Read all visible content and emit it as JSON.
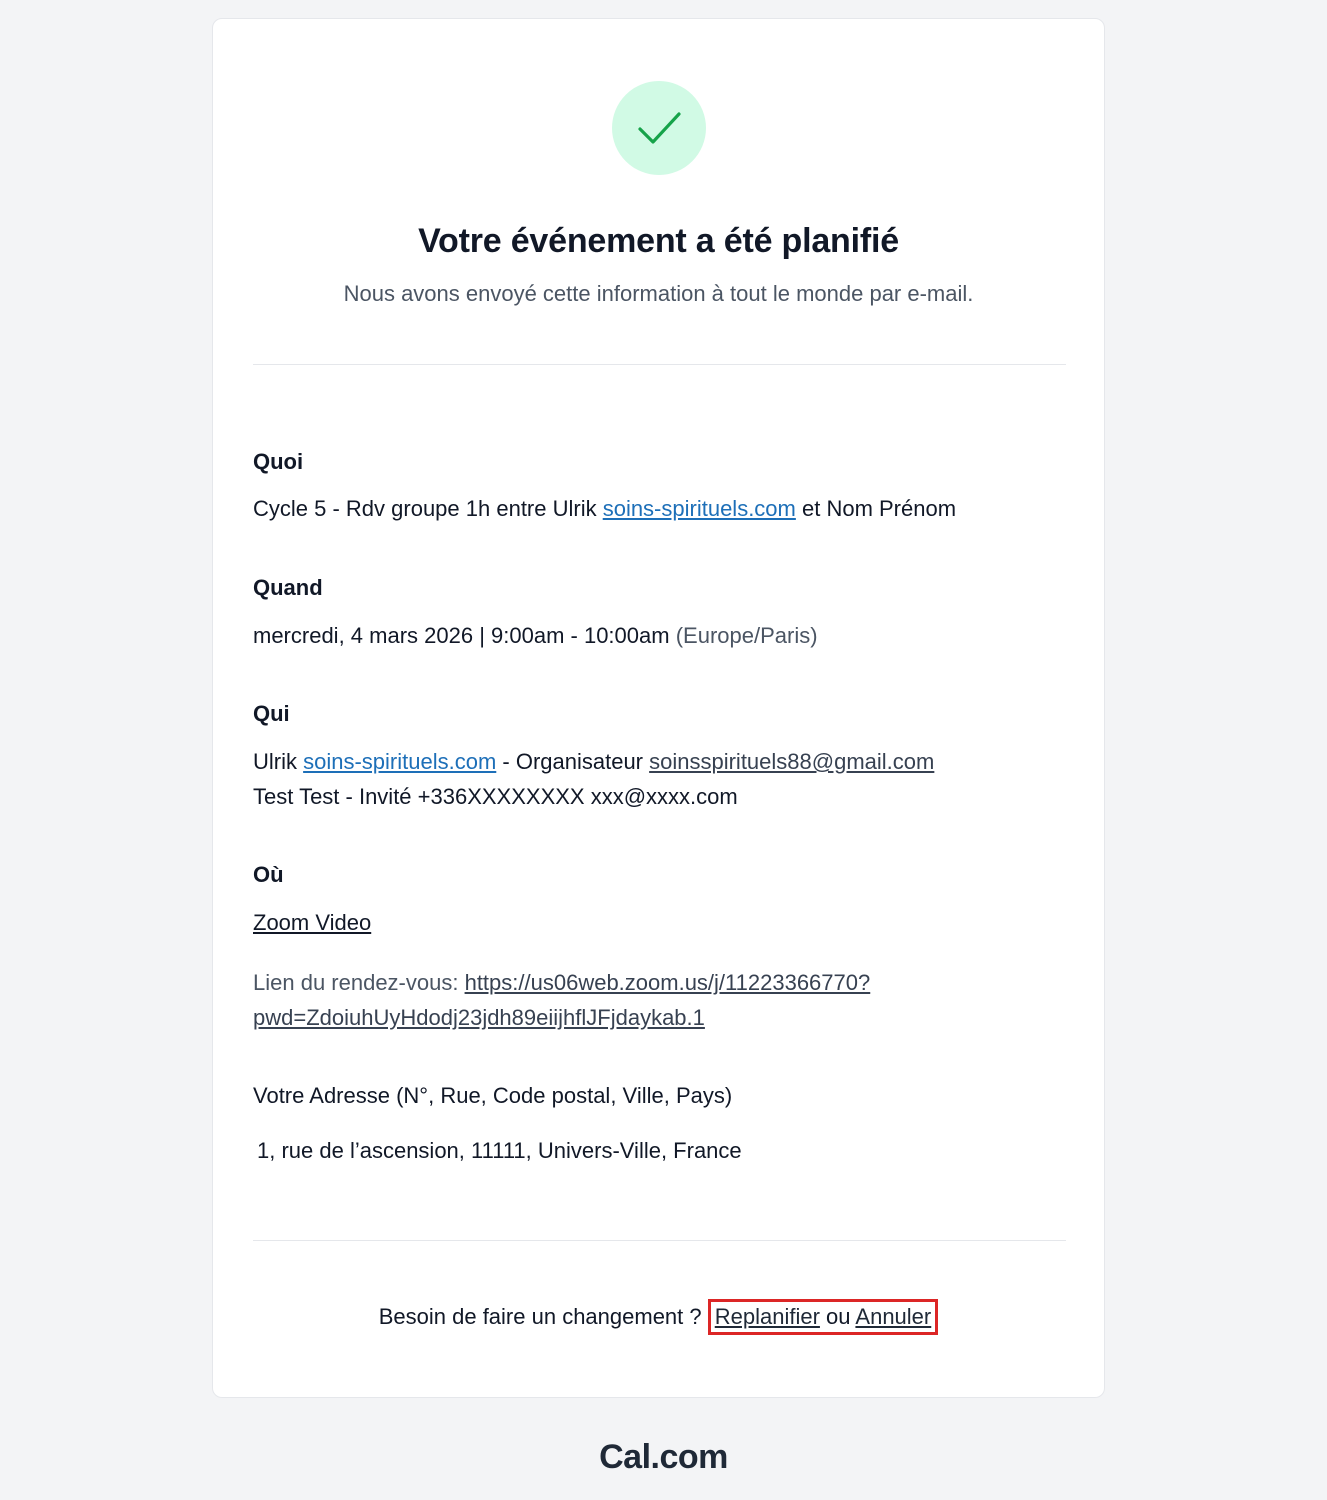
{
  "header": {
    "title": "Votre événement a été planifié",
    "subtitle": "Nous avons envoyé cette information à tout le monde par e-mail."
  },
  "what": {
    "label": "Quoi",
    "prefix": "Cycle 5 - Rdv groupe 1h entre Ulrik ",
    "link": "soins-spirituels.com",
    "suffix": " et Nom Prénom"
  },
  "when": {
    "label": "Quand",
    "datetime": "mercredi, 4 mars 2026 | 9:00am - 10:00am",
    "timezone": "(Europe/Paris)"
  },
  "who": {
    "label": "Qui",
    "organizer_name": "Ulrik ",
    "organizer_link": "soins-spirituels.com",
    "organizer_role": " - Organisateur ",
    "organizer_email": "soinsspirituels88@gmail.com",
    "guest": "Test Test - Invité +336XXXXXXXX xxx@xxxx.com"
  },
  "where": {
    "label": "Où",
    "location": "Zoom Video",
    "meeting_link_label": "Lien du rendez-vous: ",
    "meeting_link_part1": "https://us06web.zoom.us/j/11223366770?",
    "meeting_link_part2": "pwd=ZdoiuhUyHdodj23jdh89eiijhflJFjdaykab.1"
  },
  "address": {
    "label": "Votre Adresse (N°, Rue, Code postal, Ville, Pays)",
    "value": "1, rue de l’ascension, 11111, Univers-Ville, France"
  },
  "footer": {
    "question": "Besoin de faire un changement ? ",
    "reschedule": "Replanifier",
    "or": " ou ",
    "cancel": "Annuler"
  },
  "brand": {
    "name": "Cal.com"
  },
  "colors": {
    "success_bg": "#d1fae5",
    "success_check": "#16a34a",
    "link_blue": "#1d6fb8",
    "highlight": "#dc2626"
  }
}
